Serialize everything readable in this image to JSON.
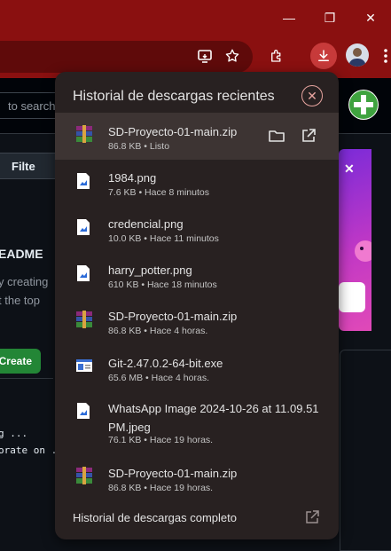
{
  "window": {
    "minimize_glyph": "—",
    "restore_glyph": "❐",
    "close_glyph": "✕"
  },
  "toolbar": {
    "icons": [
      "cast-screen-icon",
      "bookmark-star-icon",
      "extensions-icon",
      "download-icon",
      "profile-avatar",
      "more-menu-icon"
    ]
  },
  "background_page": {
    "search_placeholder": "to search",
    "filter_label": "Filte",
    "readme_title": "EADME",
    "readme_line1": "y creating",
    "readme_line2": "t the top",
    "create_label": "Create",
    "code_line1": "g ...",
    "code_line2": "orate on ."
  },
  "downloads": {
    "title": "Historial de descargas recientes",
    "items": [
      {
        "name": "SD-Proyecto-01-main.zip",
        "meta": "86.8 KB • Listo",
        "icon": "winrar-archive-icon",
        "active": true
      },
      {
        "name": "1984.png",
        "meta": "7.6 KB • Hace 8 minutos",
        "icon": "image-file-icon"
      },
      {
        "name": "credencial.png",
        "meta": "10.0 KB • Hace 11 minutos",
        "icon": "image-file-icon"
      },
      {
        "name": "harry_potter.png",
        "meta": "610 KB • Hace 18 minutos",
        "icon": "image-file-icon"
      },
      {
        "name": "SD-Proyecto-01-main.zip",
        "meta": "86.8 KB • Hace 4 horas.",
        "icon": "winrar-archive-icon"
      },
      {
        "name": "Git-2.47.0.2-64-bit.exe",
        "meta": "65.6 MB • Hace 4 horas.",
        "icon": "exe-installer-icon"
      },
      {
        "name": "WhatsApp Image 2024-10-26 at 11.09.51 PM.jpeg",
        "meta": "76.1 KB • Hace 19 horas.",
        "icon": "image-file-icon"
      },
      {
        "name": "SD-Proyecto-01-main.zip",
        "meta": "86.8 KB • Hace 19 horas.",
        "icon": "winrar-archive-icon"
      }
    ],
    "footer_label": "Historial de descargas completo"
  },
  "colors": {
    "titlebar": "#8a1010",
    "bubble_bg": "#282121",
    "active_row": "#3d3433",
    "close_ring": "#e8a5a0"
  }
}
